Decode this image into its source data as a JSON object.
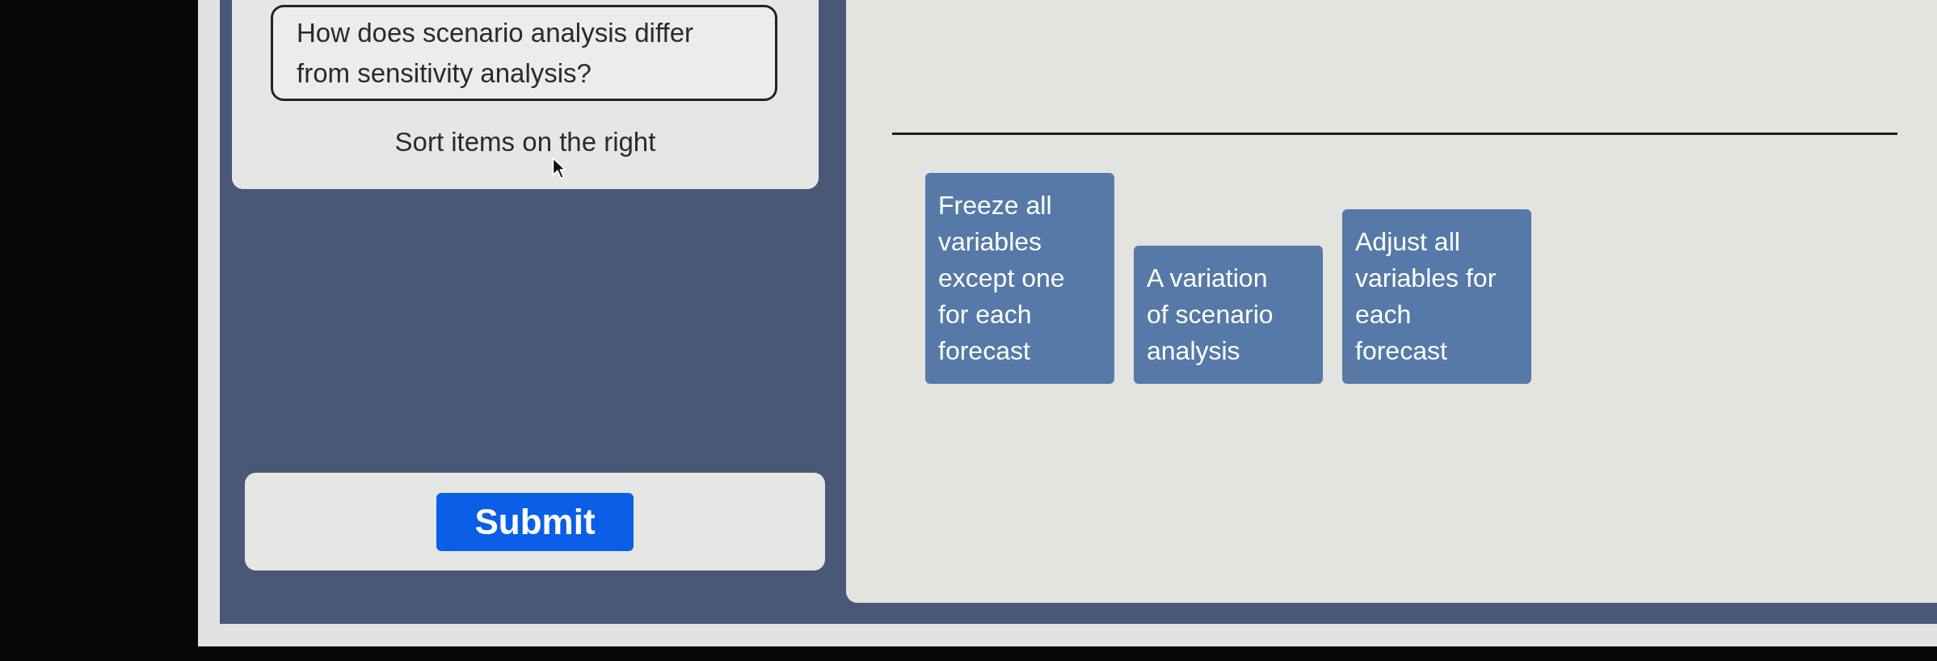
{
  "question_card": {
    "question": "How does scenario analysis differ from sensitivity analysis?",
    "instruction": "Sort items on the right"
  },
  "sort_area": {
    "items": [
      {
        "lines": [
          "Freeze all",
          "variables",
          "except one",
          "for each",
          "forecast"
        ]
      },
      {
        "lines": [
          "A variation",
          "of scenario",
          "analysis"
        ]
      },
      {
        "lines": [
          "Adjust all",
          "variables for",
          "each",
          "forecast"
        ]
      }
    ]
  },
  "submit_button": {
    "label": "Submit"
  }
}
